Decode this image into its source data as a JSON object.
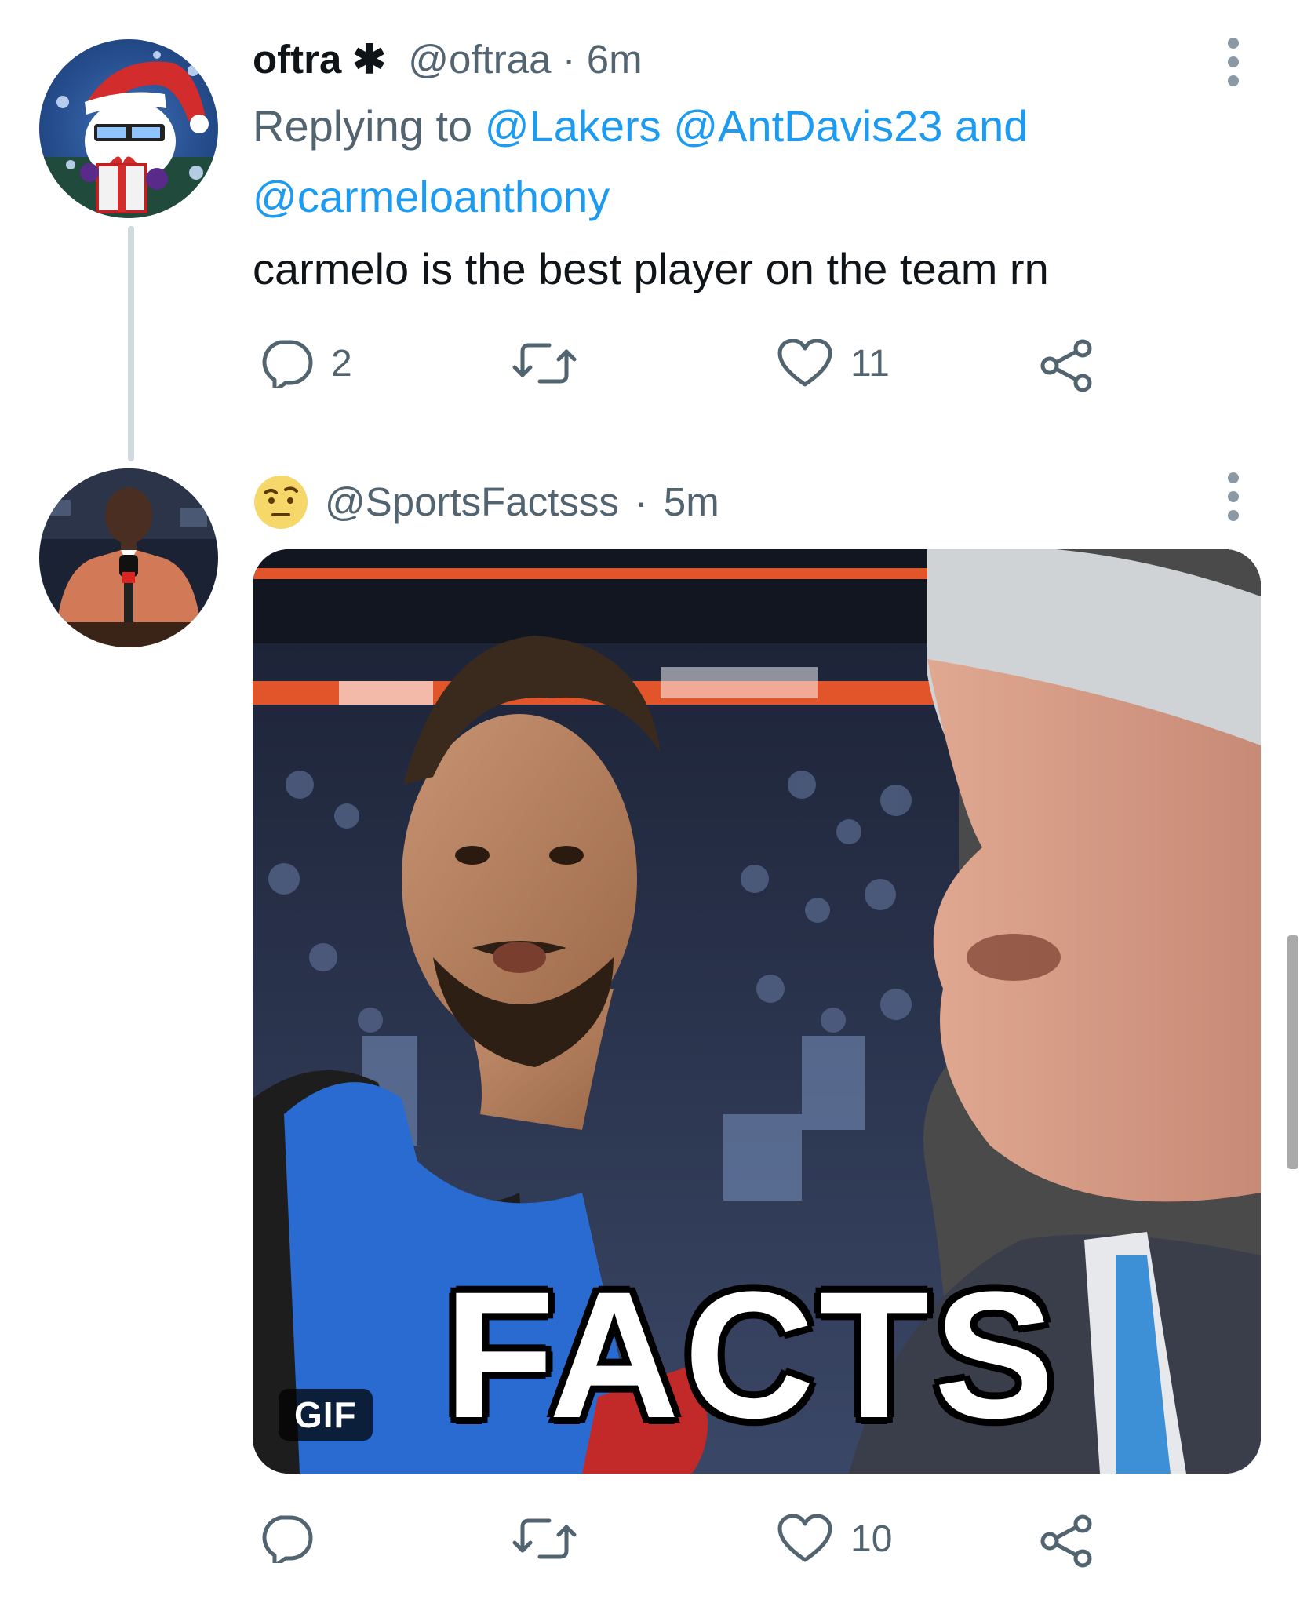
{
  "tweets": [
    {
      "display_name": "oftra",
      "name_symbol": "✱",
      "handle": "@oftraa",
      "separator": "·",
      "time": "6m",
      "replying_prefix": "Replying to ",
      "replying_mentions": [
        "@Lakers",
        "@AntDavis23"
      ],
      "replying_and": "and",
      "replying_last": "@carmeloanthony",
      "text": "carmelo is the best player on the team rn",
      "reply_count": "2",
      "like_count": "11"
    },
    {
      "handle": "@SportsFactsss",
      "separator": "·",
      "time": "5m",
      "media": {
        "caption": "FACTS",
        "badge": "GIF"
      },
      "like_count": "10"
    }
  ],
  "colors": {
    "accent": "#1d9bf0",
    "secondary_text": "#536471",
    "primary_text": "#0f1419",
    "thread_line": "#cfd9de"
  },
  "icons": [
    "reply-icon",
    "retweet-icon",
    "like-icon",
    "share-icon",
    "more-icon",
    "emoji-icon"
  ]
}
